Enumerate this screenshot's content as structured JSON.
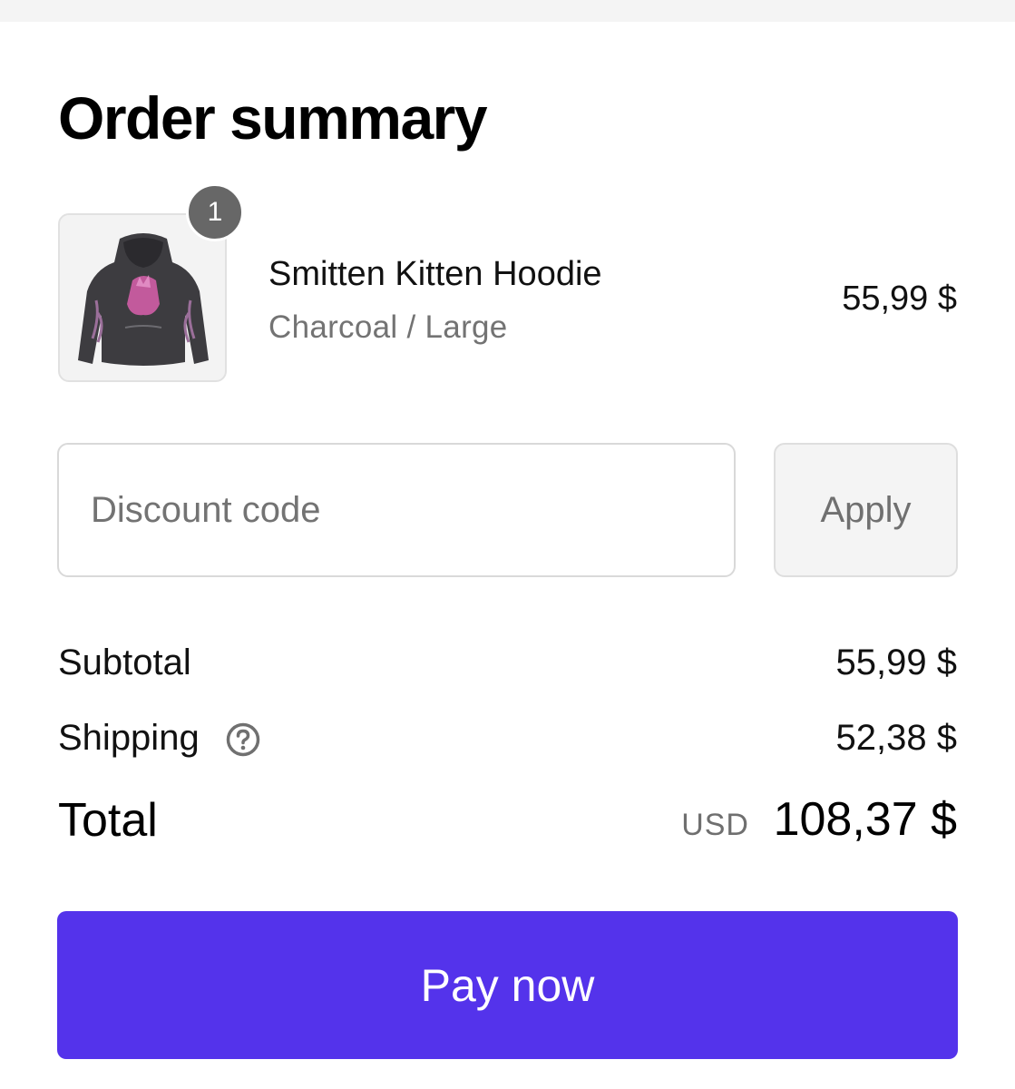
{
  "order_summary": {
    "title": "Order summary"
  },
  "line_item": {
    "quantity": "1",
    "name": "Smitten Kitten Hoodie",
    "variant": "Charcoal / Large",
    "price": "55,99 $",
    "image_icon": "hoodie-product-image"
  },
  "discount": {
    "placeholder": "Discount code",
    "value": "",
    "apply_label": "Apply"
  },
  "totals": {
    "subtotal_label": "Subtotal",
    "subtotal_value": "55,99 $",
    "shipping_label": "Shipping",
    "shipping_value": "52,38 $",
    "shipping_help_icon": "question-circle-icon",
    "total_label": "Total",
    "currency_code": "USD",
    "total_value": "108,37 $"
  },
  "pay_button": {
    "label": "Pay now"
  },
  "colors": {
    "accent": "#5433eb",
    "badge": "#676767",
    "muted_text": "#737373",
    "border": "#d9d9d9"
  }
}
